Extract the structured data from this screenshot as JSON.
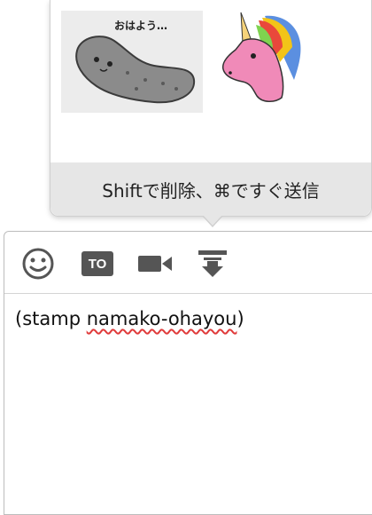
{
  "popup": {
    "stamps": [
      {
        "name": "namako-ohayou",
        "caption": "おはよう…"
      },
      {
        "name": "unicorn"
      }
    ],
    "hint": "Shiftで削除、⌘ですぐ送信"
  },
  "composer": {
    "toolbar": {
      "icons": [
        "emoji-icon",
        "to-icon",
        "video-call-icon",
        "send-file-icon"
      ],
      "to_label": "TO"
    },
    "message": {
      "prefix": "(stamp ",
      "misspelled": "namako-ohayou",
      "suffix": ")"
    }
  }
}
